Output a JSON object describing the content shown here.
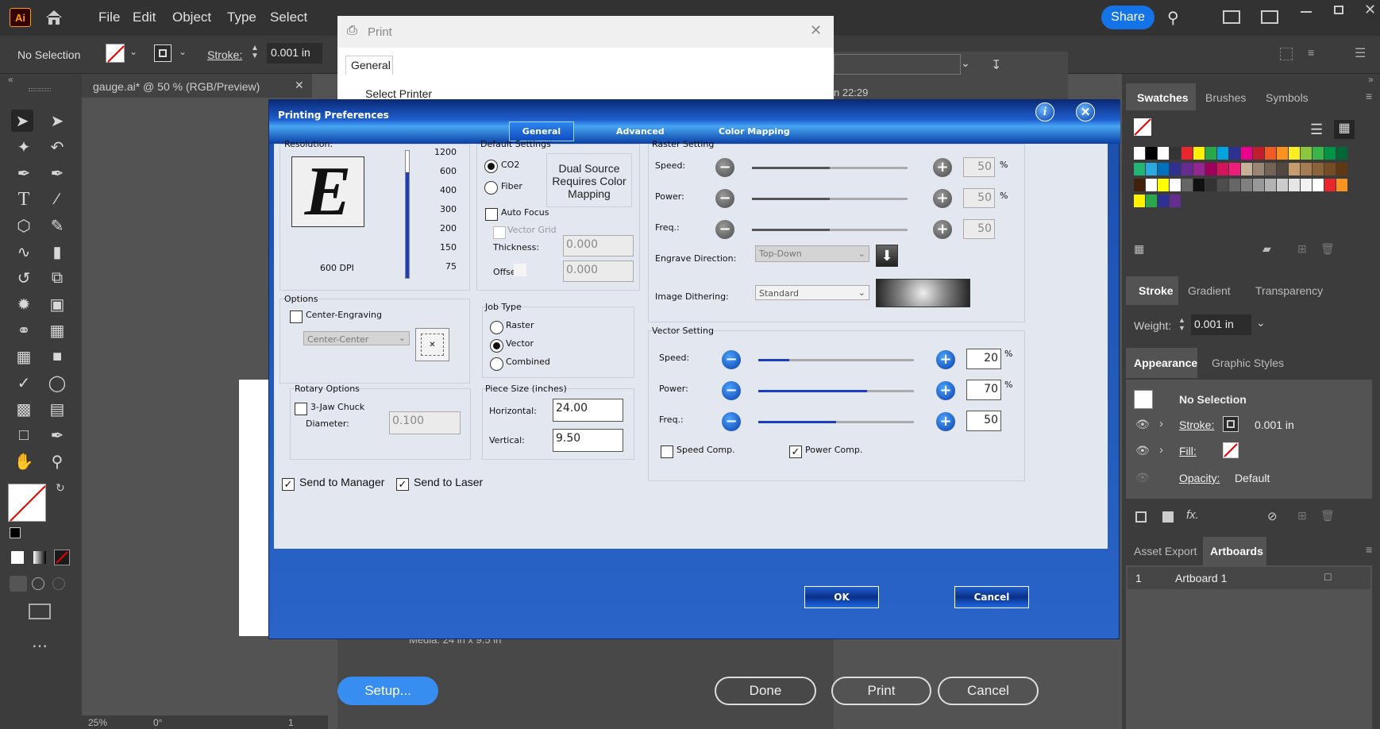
{
  "menubar": {
    "logo": "Ai",
    "items": [
      "File",
      "Edit",
      "Object",
      "Type",
      "Select"
    ],
    "share": "Share"
  },
  "control": {
    "selection": "No Selection",
    "stroke_label": "Stroke:",
    "stroke_value": "0.001 in"
  },
  "doc": {
    "tab_title": "gauge.ai* @ 50 % (RGB/Preview)",
    "zoom": "25%",
    "rotation": "0°",
    "artboard_num": "1"
  },
  "print_dialog": {
    "title": "Print",
    "tab": "General",
    "select_printer": "Select Printer",
    "time_hint": "n 22:29",
    "media": "Media: 24 in x 9.5 in",
    "setup": "Setup...",
    "done": "Done",
    "print": "Print",
    "cancel": "Cancel"
  },
  "prefs": {
    "title": "Printing Preferences",
    "tabs": [
      "General",
      "Advanced",
      "Color Mapping"
    ],
    "resolution": {
      "label": "Resolution:",
      "dpi_text": "600 DPI",
      "letter": "E",
      "scale": [
        "1200",
        "600",
        "400",
        "300",
        "200",
        "150",
        "75"
      ],
      "level": 0.83
    },
    "default_settings": {
      "label": "Default Settings",
      "co2": "CO2",
      "fiber": "Fiber",
      "dual_source": "Dual Source Requires Color Mapping",
      "auto_focus": "Auto Focus",
      "vector_grid": "Vector Grid",
      "thickness_label": "Thickness:",
      "thickness": "0.000",
      "offset_label": "Offset:",
      "offset": "0.000"
    },
    "raster": {
      "label": "Raster Setting",
      "speed_label": "Speed:",
      "speed": "50",
      "power_label": "Power:",
      "power": "50",
      "freq_label": "Freq.:",
      "freq": "50",
      "pct": "%",
      "engrave_dir_label": "Engrave Direction:",
      "engrave_dir": "Top-Down",
      "dithering_label": "Image Dithering:",
      "dithering": "Standard"
    },
    "options": {
      "label": "Options",
      "center_engraving": "Center-Engraving",
      "center_select": "Center-Center"
    },
    "job_type": {
      "label": "Job Type",
      "raster": "Raster",
      "vector": "Vector",
      "combined": "Combined"
    },
    "rotary": {
      "label": "Rotary Options",
      "jaw": "3-Jaw Chuck",
      "diameter_label": "Diameter:",
      "diameter": "0.100"
    },
    "piece": {
      "label": "Piece Size (inches)",
      "horizontal_label": "Horizontal:",
      "horizontal": "24.00",
      "vertical_label": "Vertical:",
      "vertical": "9.50"
    },
    "vector": {
      "label": "Vector Setting",
      "speed_label": "Speed:",
      "speed": "20",
      "power_label": "Power:",
      "power": "70",
      "freq_label": "Freq.:",
      "freq": "50",
      "speed_comp": "Speed Comp.",
      "power_comp": "Power Comp.",
      "pct": "%"
    },
    "send_manager": "Send to Manager",
    "send_laser": "Send to Laser",
    "ok": "OK",
    "cancel": "Cancel"
  },
  "panels": {
    "swatch_tabs": [
      "Swatches",
      "Brushes",
      "Symbols"
    ],
    "stroke_tabs": [
      "Stroke",
      "Gradient",
      "Transparency"
    ],
    "weight_label": "Weight:",
    "weight": "0.001 in",
    "appearance_tabs": [
      "Appearance",
      "Graphic Styles"
    ],
    "no_selection": "No Selection",
    "stroke_label": "Stroke:",
    "stroke_value": "0.001 in",
    "fill_label": "Fill:",
    "opacity_label": "Opacity:",
    "opacity_value": "Default",
    "asset_tabs": [
      "Asset Export",
      "Artboards"
    ],
    "artboard_num": "1",
    "artboard_name": "Artboard 1"
  },
  "colors": {
    "accent": "#1473e6",
    "dialog_blue": "#1f5fd0"
  }
}
